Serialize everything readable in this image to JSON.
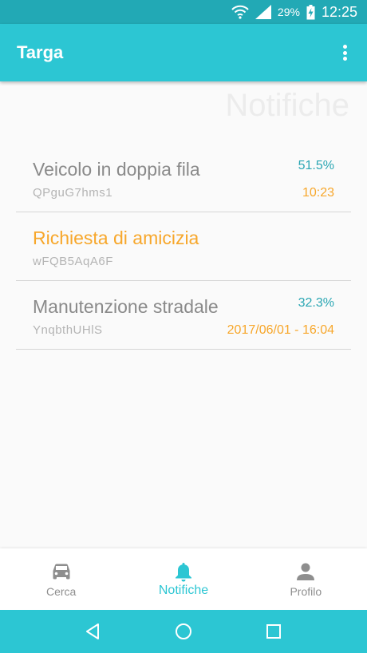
{
  "status_bar": {
    "battery": "29%",
    "time": "12:25"
  },
  "app_bar": {
    "title": "Targa"
  },
  "page": {
    "watermark": "Notifiche"
  },
  "notifications": [
    {
      "title": "Veicolo in doppia fila",
      "code": "QPguG7hms1",
      "percent": "51.5%",
      "time": "10:23",
      "title_color": "gray"
    },
    {
      "title": "Richiesta di amicizia",
      "code": "wFQB5AqA6F",
      "percent": "",
      "time": "",
      "title_color": "orange"
    },
    {
      "title": "Manutenzione stradale",
      "code": "YnqbthUHlS",
      "percent": "32.3%",
      "time": "2017/06/01 - 16:04",
      "title_color": "gray"
    }
  ],
  "bottom_nav": {
    "tabs": [
      {
        "label": "Cerca",
        "icon": "car-icon",
        "active": false
      },
      {
        "label": "Notifiche",
        "icon": "bell-icon",
        "active": true
      },
      {
        "label": "Profilo",
        "icon": "person-icon",
        "active": false
      }
    ]
  },
  "colors": {
    "primary": "#2cc6d3",
    "status_bar": "#22a9b5",
    "accent_orange": "#f7a72b",
    "percent_teal": "#2aa6b3"
  }
}
